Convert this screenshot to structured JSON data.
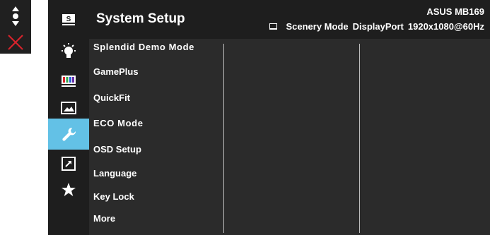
{
  "header": {
    "title": "System Setup",
    "model": "ASUS MB169",
    "mode": "Scenery Mode",
    "input": "DisplayPort",
    "resolution": "1920x1080@60Hz"
  },
  "menu": {
    "items": [
      "Splendid Demo Mode",
      "GamePlus",
      "QuickFit",
      "ECO Mode",
      "OSD Setup",
      "Language",
      "Key Lock",
      "More"
    ]
  },
  "icons": [
    "splendid-icon",
    "lightbulb-icon",
    "color-bars-icon",
    "image-icon",
    "wrench-icon",
    "shortcut-arrow-icon",
    "star-icon"
  ],
  "nav": {
    "icons": [
      "up-down-arrows-icon",
      "close-icon"
    ]
  },
  "colors": {
    "accent": "#63c1e6",
    "close": "#d9232c",
    "background": "#2b2b2b"
  }
}
